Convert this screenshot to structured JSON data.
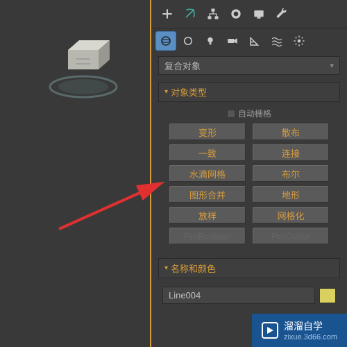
{
  "dropdown": {
    "selected": "复合对象"
  },
  "rollouts": {
    "objectType": {
      "title": "对象类型",
      "autogrid": "自动栅格"
    },
    "nameColor": {
      "title": "名称和颜色"
    }
  },
  "buttons": {
    "morph": "变形",
    "scatter": "散布",
    "conform": "一致",
    "connect": "连接",
    "blobmesh": "水滴网格",
    "boolean": "布尔",
    "shapemerge": "图形合并",
    "terrain": "地形",
    "loft": "放样",
    "mesher": "网格化",
    "proboolean": "ProBoolean",
    "procutter": "ProCutter"
  },
  "nameField": {
    "value": "Line004"
  },
  "watermark": {
    "brand": "溜溜自学",
    "url": "zixue.3d66.com"
  },
  "colors": {
    "accent": "#d79c3b",
    "swatch": "#d9d060",
    "wmBg": "#1a5490"
  }
}
